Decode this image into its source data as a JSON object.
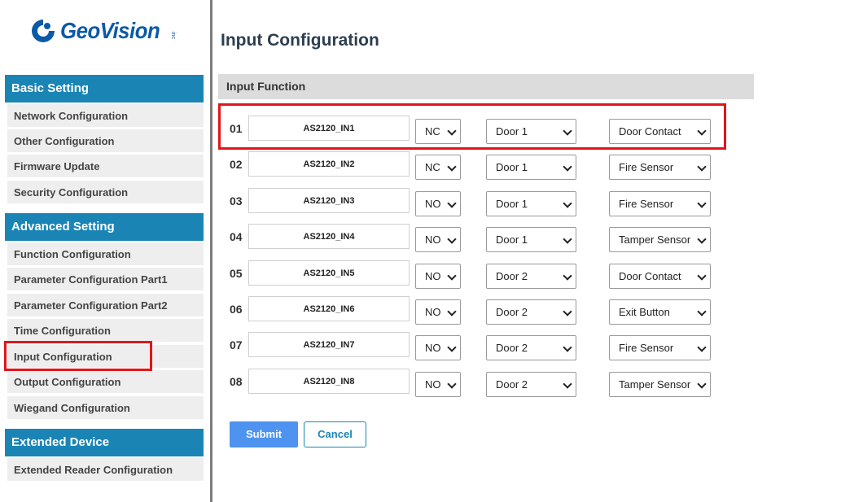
{
  "logo": {
    "text": "GeoVision",
    "suffix": "inc"
  },
  "sidebar": {
    "sections": [
      {
        "title": "Basic Setting",
        "items": [
          {
            "label": "Network Configuration"
          },
          {
            "label": "Other Configuration"
          },
          {
            "label": "Firmware Update"
          },
          {
            "label": "Security Configuration"
          }
        ]
      },
      {
        "title": "Advanced Setting",
        "items": [
          {
            "label": "Function Configuration"
          },
          {
            "label": "Parameter Configuration Part1"
          },
          {
            "label": "Parameter Configuration Part2"
          },
          {
            "label": "Time Configuration"
          },
          {
            "label": "Input Configuration"
          },
          {
            "label": "Output Configuration"
          },
          {
            "label": "Wiegand Configuration"
          }
        ]
      },
      {
        "title": "Extended Device",
        "items": [
          {
            "label": "Extended Reader Configuration"
          }
        ]
      }
    ]
  },
  "main": {
    "title": "Input Configuration",
    "section_header": "Input Function",
    "rows": [
      {
        "num": "01",
        "name": "AS2120_IN1",
        "state": "NC",
        "door": "Door 1",
        "type": "Door Contact"
      },
      {
        "num": "02",
        "name": "AS2120_IN2",
        "state": "NC",
        "door": "Door 1",
        "type": "Fire Sensor"
      },
      {
        "num": "03",
        "name": "AS2120_IN3",
        "state": "NO",
        "door": "Door 1",
        "type": "Fire Sensor"
      },
      {
        "num": "04",
        "name": "AS2120_IN4",
        "state": "NO",
        "door": "Door 1",
        "type": "Tamper Sensor"
      },
      {
        "num": "05",
        "name": "AS2120_IN5",
        "state": "NO",
        "door": "Door 2",
        "type": "Door Contact"
      },
      {
        "num": "06",
        "name": "AS2120_IN6",
        "state": "NO",
        "door": "Door 2",
        "type": "Exit Button"
      },
      {
        "num": "07",
        "name": "AS2120_IN7",
        "state": "NO",
        "door": "Door 2",
        "type": "Fire Sensor"
      },
      {
        "num": "08",
        "name": "AS2120_IN8",
        "state": "NO",
        "door": "Door 2",
        "type": "Tamper Sensor"
      }
    ],
    "submit_label": "Submit",
    "cancel_label": "Cancel"
  },
  "colors": {
    "accent": "#1a85b5",
    "submit": "#4d93ef",
    "highlight": "#e0161b",
    "brand": "#0b5aa6"
  },
  "icons": {
    "logo_mark": "geovision-logo-icon",
    "dropdown": "chevron-down-icon"
  }
}
